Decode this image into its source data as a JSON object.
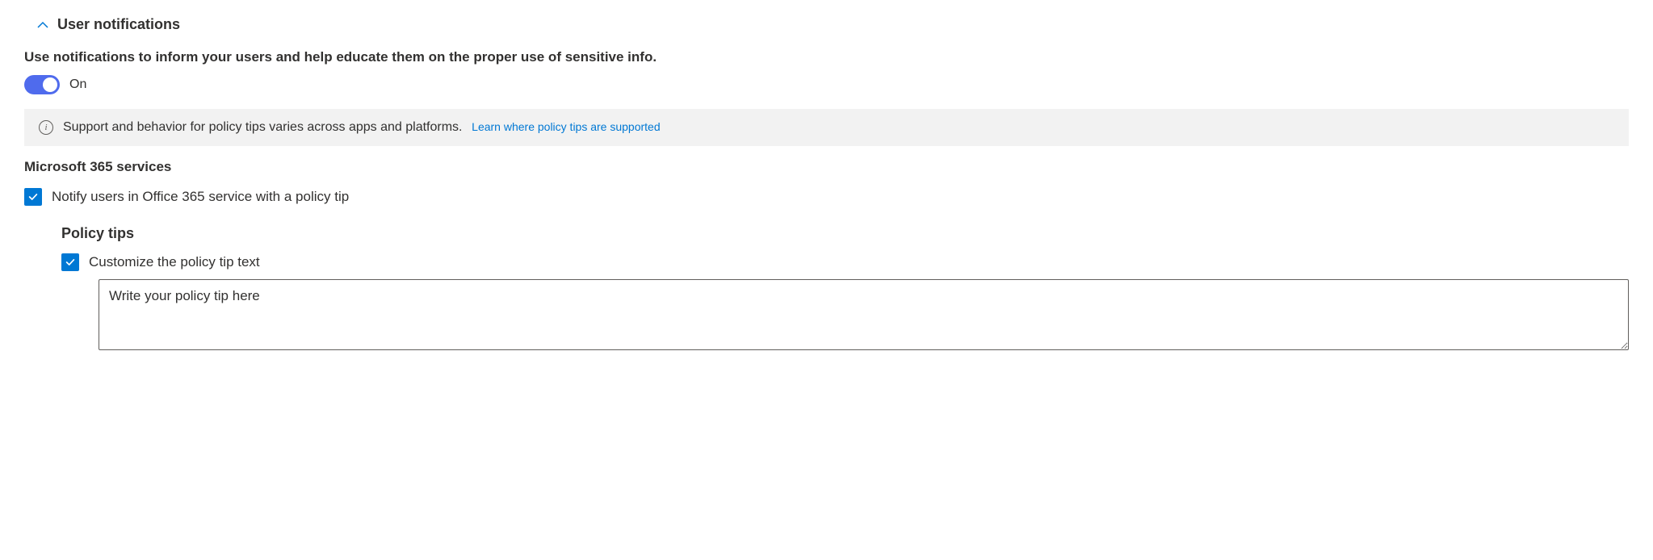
{
  "section": {
    "title": "User notifications",
    "description": "Use notifications to inform your users and help educate them on the proper use of sensitive info.",
    "toggle": {
      "state": "On"
    },
    "info": {
      "text": "Support and behavior for policy tips varies across apps and platforms.",
      "link_text": "Learn where policy tips are supported"
    },
    "subsection_title": "Microsoft 365 services",
    "checkbox_notify": {
      "label": "Notify users in Office 365 service with a policy tip",
      "checked": true
    },
    "policy_tips": {
      "title": "Policy tips",
      "customize_checkbox": {
        "label": "Customize the policy tip text",
        "checked": true
      },
      "textarea_value": "Write your policy tip here"
    }
  }
}
